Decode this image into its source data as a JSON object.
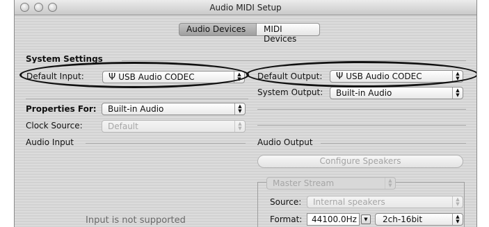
{
  "window": {
    "title": "Audio MIDI Setup"
  },
  "tabs": [
    {
      "label": "Audio Devices",
      "selected": true
    },
    {
      "label": "MIDI Devices",
      "selected": false
    }
  ],
  "system_settings": {
    "heading": "System Settings",
    "default_input": {
      "label": "Default Input:",
      "value": "USB Audio CODEC",
      "icon": "usb-icon"
    },
    "default_output": {
      "label": "Default Output:",
      "value": "USB Audio CODEC",
      "icon": "usb-icon"
    },
    "system_output": {
      "label": "System Output:",
      "value": "Built-in Audio"
    }
  },
  "properties": {
    "label": "Properties For:",
    "value": "Built-in Audio",
    "clock_source": {
      "label": "Clock Source:",
      "value": "Default"
    }
  },
  "audio_input": {
    "heading": "Audio Input",
    "message": "Input is not supported"
  },
  "audio_output": {
    "heading": "Audio Output",
    "configure_label": "Configure Speakers",
    "stream": "Master Stream",
    "source": {
      "label": "Source:",
      "value": "Internal speakers"
    },
    "format": {
      "label": "Format:",
      "rate": "44100.0Hz",
      "channels": "2ch-16bit"
    }
  },
  "colors": {
    "highlight_ellipse": "#111111",
    "window_stripe": "#dcdcdc"
  }
}
